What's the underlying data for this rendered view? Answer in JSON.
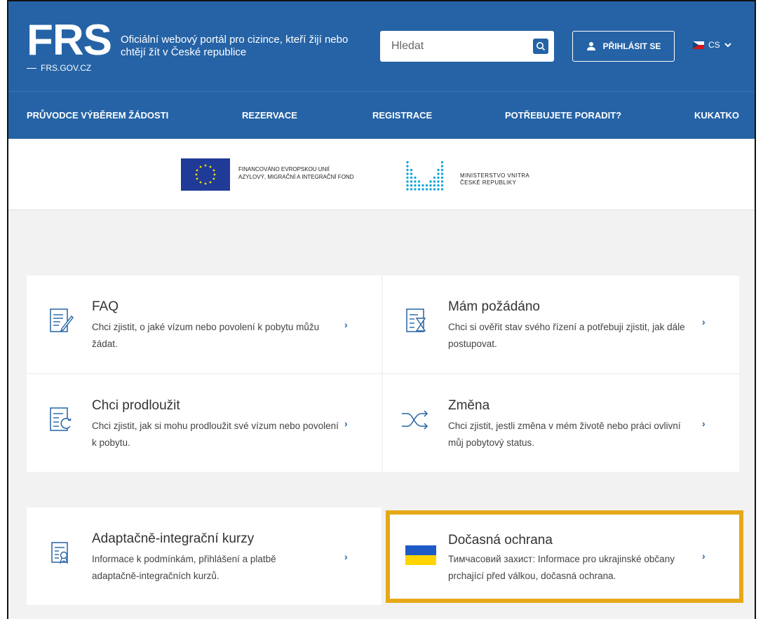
{
  "header": {
    "logo_text": "FRS",
    "logo_sub": "FRS.GOV.CZ",
    "tagline": "Oficiální webový portál pro cizince, kteří žijí nebo chtějí žít v České republice",
    "search_placeholder": "Hledat",
    "login_label": "PŘIHLÁSIT SE",
    "language": "CS"
  },
  "nav": {
    "items": [
      "PRŮVODCE VÝBĚREM ŽÁDOSTI",
      "REZERVACE",
      "REGISTRACE",
      "POTŘEBUJETE PORADIT?",
      "KUKATKO"
    ]
  },
  "sponsors": {
    "eu_line1": "FINANCOVÁNO EVROPSKOU UNIÍ",
    "eu_line2": "AZYLOVÝ, MIGRAČNÍ A INTEGRAČNÍ FOND",
    "mv_line1": "MINISTERSTVO VNITRA",
    "mv_line2": "ČESKÉ REPUBLIKY"
  },
  "cards": [
    {
      "title": "FAQ",
      "desc": "Chci zjistit, o jaké vízum nebo povolení k pobytu můžu žádat.",
      "icon": "document-edit-icon"
    },
    {
      "title": "Mám požádáno",
      "desc": "Chci si ověřit stav svého řízení a potřebuji zjistit, jak dále postupovat.",
      "icon": "document-hourglass-icon"
    },
    {
      "title": "Chci prodloužit",
      "desc": "Chci zjistit, jak si mohu prodloužit své vízum nebo povolení k pobytu.",
      "icon": "document-renew-icon"
    },
    {
      "title": "Změna",
      "desc": "Chci zjistit, jestli změna v mém životě nebo práci ovlivní můj pobytový status.",
      "icon": "shuffle-icon"
    },
    {
      "title": "Adaptačně-integrační kurzy",
      "desc": "Informace k podmínkám, přihlášení a platbě adaptačně-integračních kurzů.",
      "icon": "certificate-icon"
    },
    {
      "title": "Dočasná ochrana",
      "desc": "Тимчасовий захист: Informace pro ukrajinské občany prchající před válkou, dočasná ochrana.",
      "icon": "ukraine-flag-icon"
    }
  ],
  "colors": {
    "brand_blue": "#2563a6",
    "highlight": "#e6a817",
    "background": "#f2f2f2"
  }
}
